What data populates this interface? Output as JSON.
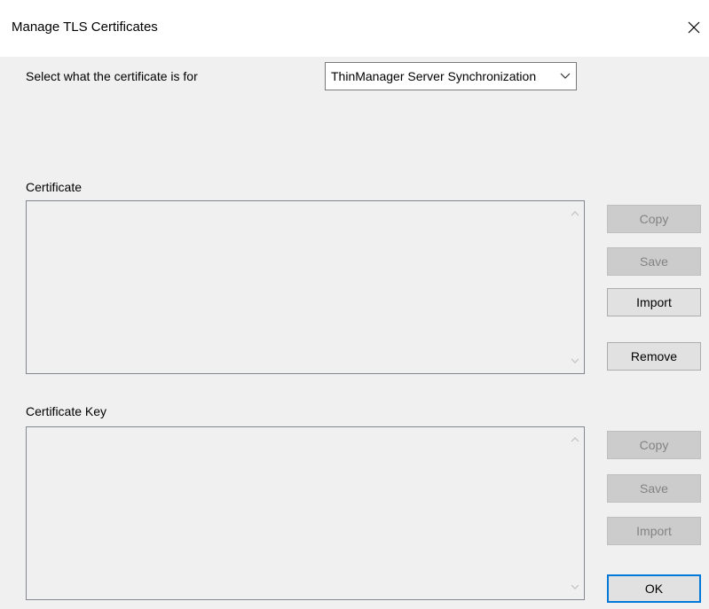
{
  "window": {
    "title": "Manage TLS Certificates"
  },
  "purpose": {
    "label": "Select what the certificate is for",
    "selected": "ThinManager Server Synchronization"
  },
  "certificate": {
    "label": "Certificate",
    "buttons": {
      "copy": "Copy",
      "save": "Save",
      "import": "Import",
      "remove": "Remove"
    }
  },
  "certificate_key": {
    "label": "Certificate Key",
    "buttons": {
      "copy": "Copy",
      "save": "Save",
      "import": "Import"
    }
  },
  "footer": {
    "ok": "OK"
  },
  "icons": [
    "close-icon",
    "chevron-down-icon",
    "scroll-up-icon",
    "scroll-down-icon"
  ],
  "colors": {
    "accent": "#0078d7",
    "disabled_text": "#838383"
  }
}
